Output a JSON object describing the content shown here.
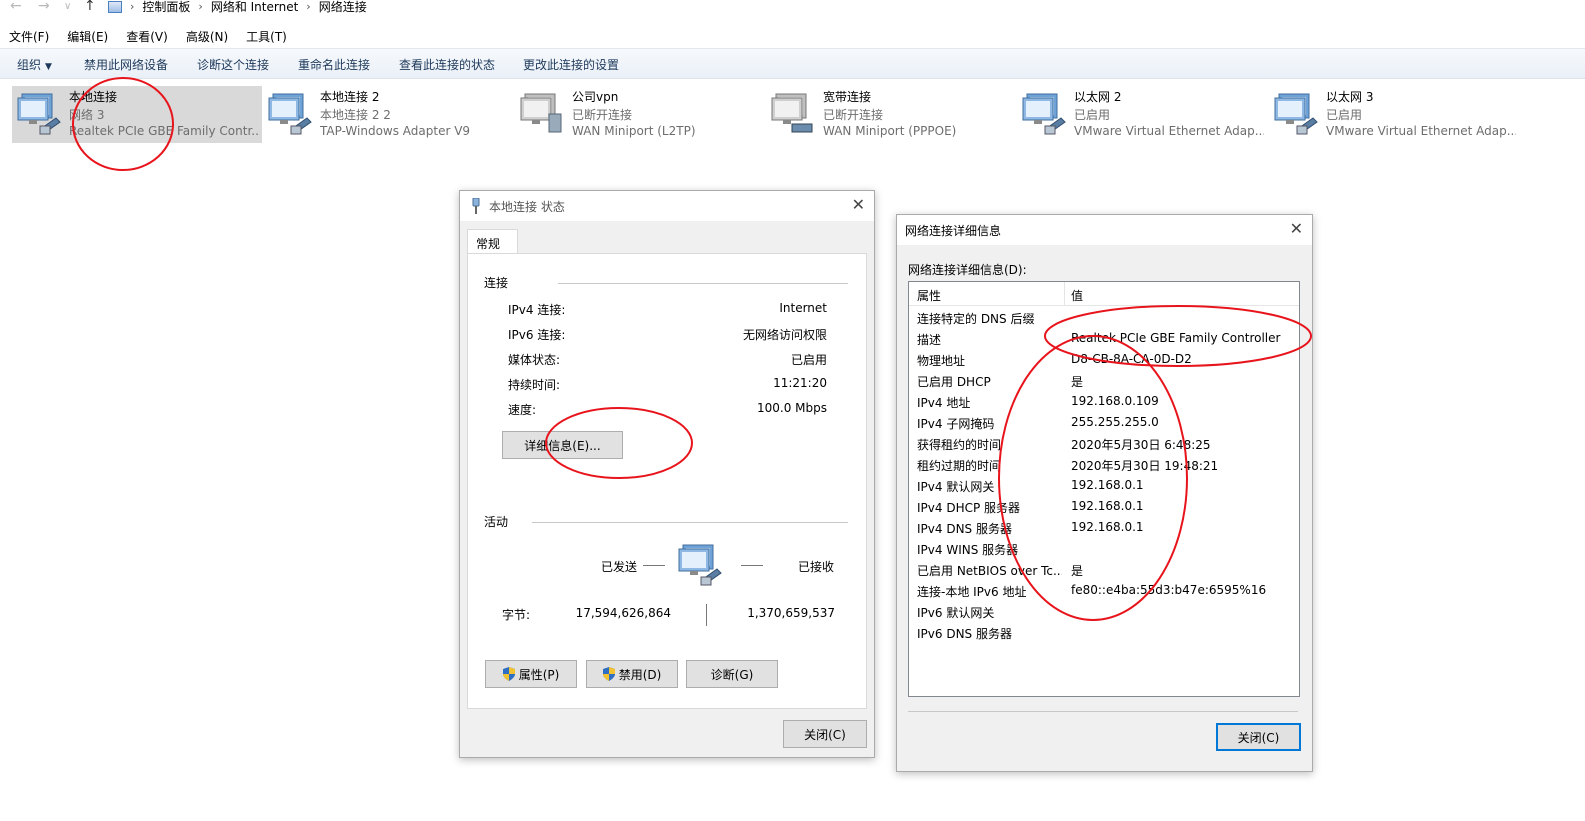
{
  "address": {
    "crumbs": [
      "控制面板",
      "网络和 Internet",
      "网络连接"
    ]
  },
  "menu": [
    "文件(F)",
    "编辑(E)",
    "查看(V)",
    "高级(N)",
    "工具(T)"
  ],
  "commands": [
    "组织",
    "禁用此网络设备",
    "诊断这个连接",
    "重命名此连接",
    "查看此连接的状态",
    "更改此连接的设置"
  ],
  "adapters": [
    {
      "name": "本地连接",
      "status": "网络  3",
      "device": "Realtek PCIe GBE Family Contr..."
    },
    {
      "name": "本地连接 2",
      "status": "本地连接 2 2",
      "device": "TAP-Windows Adapter V9"
    },
    {
      "name": "公司vpn",
      "status": "已断开连接",
      "device": "WAN Miniport (L2TP)"
    },
    {
      "name": "宽带连接",
      "status": "已断开连接",
      "device": "WAN Miniport (PPPOE)"
    },
    {
      "name": "以太网 2",
      "status": "已启用",
      "device": "VMware Virtual Ethernet Adap..."
    },
    {
      "name": "以太网 3",
      "status": "已启用",
      "device": "VMware Virtual Ethernet Adap..."
    }
  ],
  "status_dialog": {
    "title": "本地连接 状态",
    "tab": "常规",
    "connection_label": "连接",
    "rows": [
      {
        "k": "IPv4 连接:",
        "v": "Internet"
      },
      {
        "k": "IPv6 连接:",
        "v": "无网络访问权限"
      },
      {
        "k": "媒体状态:",
        "v": "已启用"
      },
      {
        "k": "持续时间:",
        "v": "11:21:20"
      },
      {
        "k": "速度:",
        "v": "100.0 Mbps"
      }
    ],
    "details_button": "详细信息(E)...",
    "activity_label": "活动",
    "sent_label": "已发送",
    "received_label": "已接收",
    "bytes_label": "字节:",
    "bytes_sent": "17,594,626,864",
    "bytes_received": "1,370,659,537",
    "properties_button": "属性(P)",
    "disable_button": "禁用(D)",
    "diagnose_button": "诊断(G)",
    "close_button": "关闭(C)"
  },
  "details_dialog": {
    "title": "网络连接详细信息",
    "label": "网络连接详细信息(D):",
    "col_property": "属性",
    "col_value": "值",
    "rows": [
      {
        "p": "连接特定的 DNS 后缀",
        "v": ""
      },
      {
        "p": "描述",
        "v": "Realtek PCIe GBE Family Controller"
      },
      {
        "p": "物理地址",
        "v": "D8-CB-8A-CA-0D-D2"
      },
      {
        "p": "已启用 DHCP",
        "v": "是"
      },
      {
        "p": "IPv4 地址",
        "v": "192.168.0.109"
      },
      {
        "p": "IPv4 子网掩码",
        "v": "255.255.255.0"
      },
      {
        "p": "获得租约的时间",
        "v": "2020年5月30日 6:48:25"
      },
      {
        "p": "租约过期的时间",
        "v": "2020年5月30日 19:48:21"
      },
      {
        "p": "IPv4 默认网关",
        "v": "192.168.0.1"
      },
      {
        "p": "IPv4 DHCP 服务器",
        "v": "192.168.0.1"
      },
      {
        "p": "IPv4 DNS 服务器",
        "v": "192.168.0.1"
      },
      {
        "p": "IPv4 WINS 服务器",
        "v": ""
      },
      {
        "p": "已启用 NetBIOS over Tc...",
        "v": "是"
      },
      {
        "p": "连接-本地 IPv6 地址",
        "v": "fe80::e4ba:55d3:b47e:6595%16"
      },
      {
        "p": "IPv6 默认网关",
        "v": ""
      },
      {
        "p": "IPv6 DNS 服务器",
        "v": ""
      }
    ],
    "close_button": "关闭(C)"
  },
  "colors": {
    "annotation": "#e8141c",
    "selection": "#d9d9d9",
    "accent": "#0078d7"
  }
}
